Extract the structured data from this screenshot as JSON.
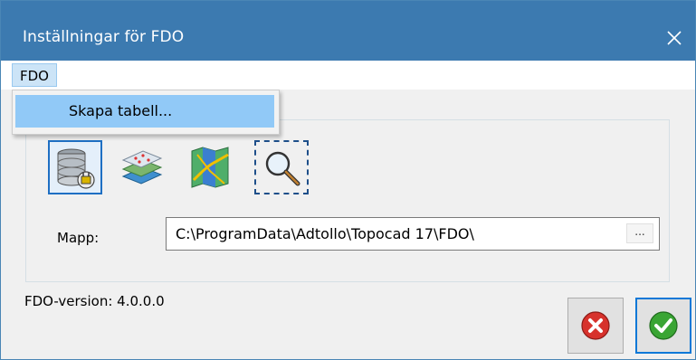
{
  "window": {
    "title": "Inställningar för FDO"
  },
  "menu": {
    "fdo_label": "FDO",
    "items": [
      {
        "label": "Skapa tabell..."
      }
    ]
  },
  "toolbar": {
    "icons": [
      "database-plug-icon",
      "layers-map-icon",
      "map-roads-icon",
      "zoom-selection-icon"
    ],
    "selected_index": 0
  },
  "mapp": {
    "label": "Mapp:",
    "value": "C:\\ProgramData\\Adtollo\\Topocad 17\\FDO\\",
    "browse_label": "..."
  },
  "version_text": "FDO-version: 4.0.0.0",
  "buttons": {
    "cancel_icon": "cancel-icon",
    "ok_icon": "ok-check-icon"
  },
  "colors": {
    "titlebar": "#3c7ab0",
    "menu_highlight": "#91c9f7",
    "ok_green": "#3aa534",
    "cancel_red": "#d7322c"
  }
}
